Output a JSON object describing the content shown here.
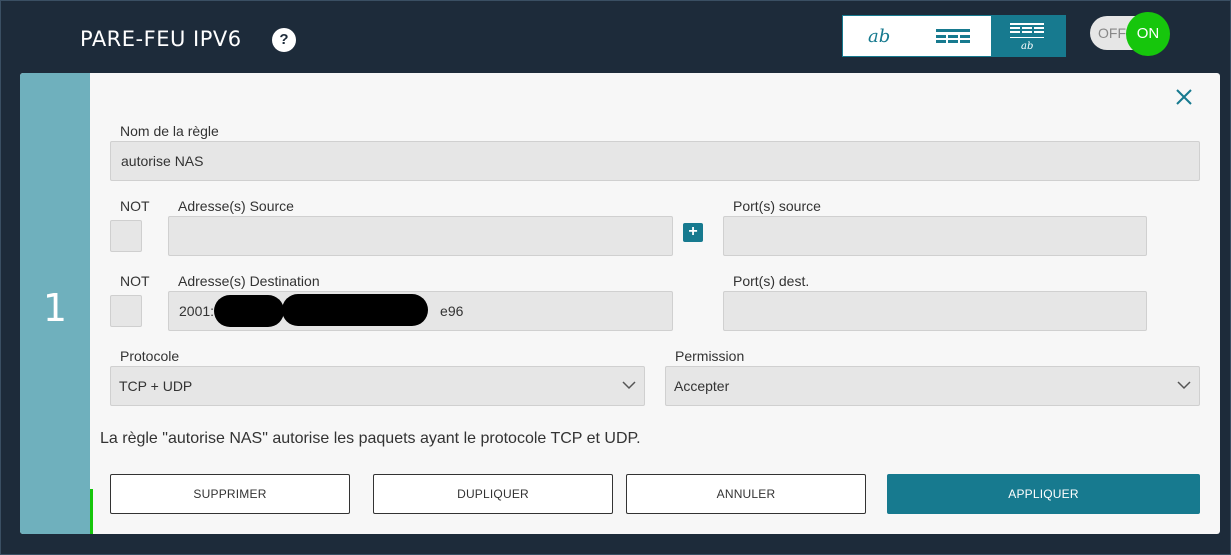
{
  "header": {
    "title": "PARE-FEU IPV6",
    "help_label": "?",
    "view_modes": [
      {
        "icon": "handwriting-view-icon",
        "active": false
      },
      {
        "icon": "table-view-icon",
        "active": false
      },
      {
        "icon": "combined-view-icon",
        "active": true
      }
    ],
    "toggle": {
      "off_label": "OFF",
      "on_label": "ON",
      "state": "on"
    }
  },
  "rule": {
    "number": "1",
    "name_label": "Nom de la règle",
    "name_value": "autorise NAS",
    "not_label_source": "NOT",
    "source_label": "Adresse(s) Source",
    "source_value": "",
    "add_label": "+",
    "source_port_label": "Port(s) source",
    "source_port_value": "",
    "not_label_dest": "NOT",
    "dest_label": "Adresse(s) Destination",
    "dest_value_prefix": "2001:",
    "dest_value_suffix": "e96",
    "dest_port_label": "Port(s) dest.",
    "dest_port_value": "",
    "protocol_label": "Protocole",
    "protocol_value": "TCP + UDP",
    "permission_label": "Permission",
    "permission_value": "Accepter",
    "summary": "La règle \"autorise NAS\" autorise les paquets ayant le protocole TCP et UDP."
  },
  "actions": {
    "delete": "SUPPRIMER",
    "duplicate": "DUPLIQUER",
    "cancel": "ANNULER",
    "apply": "APPLIQUER"
  },
  "colors": {
    "background": "#1d2b3a",
    "accent": "#177a8f",
    "strip": "#6fb0bd",
    "on_green": "#16c60c"
  }
}
